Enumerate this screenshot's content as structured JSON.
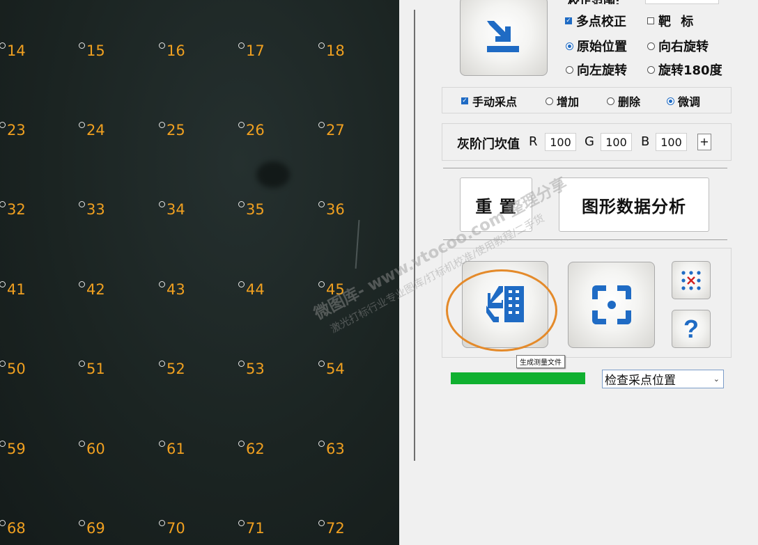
{
  "canvas": {
    "rows": [
      [
        "14",
        "15",
        "16",
        "17",
        "18"
      ],
      [
        "23",
        "24",
        "25",
        "26",
        "27"
      ],
      [
        "32",
        "33",
        "34",
        "35",
        "36"
      ],
      [
        "41",
        "42",
        "43",
        "44",
        "45"
      ],
      [
        "50",
        "51",
        "52",
        "53",
        "54"
      ],
      [
        "59",
        "60",
        "61",
        "62",
        "63"
      ],
      [
        "68",
        "69",
        "70",
        "71",
        "72"
      ]
    ]
  },
  "panel": {
    "top_clipped_label": "校正范围:",
    "correction": {
      "multipoint": {
        "label": "多点校正",
        "checked": true
      },
      "target": {
        "label": "靶 标",
        "checked": false
      }
    },
    "rotation": {
      "original": "原始位置",
      "rotate_right": "向右旋转",
      "rotate_left": "向左旋转",
      "rotate_180": "旋转180度",
      "selected": "原始位置"
    },
    "sampling": {
      "manual": {
        "label": "手动采点",
        "checked": true
      },
      "add": "增加",
      "delete": "删除",
      "finetune": "微调",
      "selected": "微调"
    },
    "threshold": {
      "label": "灰阶门坎值",
      "r_label": "R",
      "r_value": "100",
      "g_label": "G",
      "g_value": "100",
      "b_label": "B",
      "b_value": "100",
      "plus_label": "+"
    },
    "reset_button": "重 置",
    "analysis_button": "图形数据分析",
    "tooltip": "生成测量文件",
    "progress": 1.0,
    "check_select": "检查采点位置",
    "help_label": "?"
  },
  "watermark": {
    "line1": "微图库- www.vtocoo.com 整理分享",
    "line2": "激光打标行业专业图库/打标机校准/使用教程/二手货"
  },
  "colors": {
    "accent": "#1f6bc4",
    "number": "#f0a020",
    "progress": "#10b030",
    "highlight_circle": "#e48a2a"
  }
}
